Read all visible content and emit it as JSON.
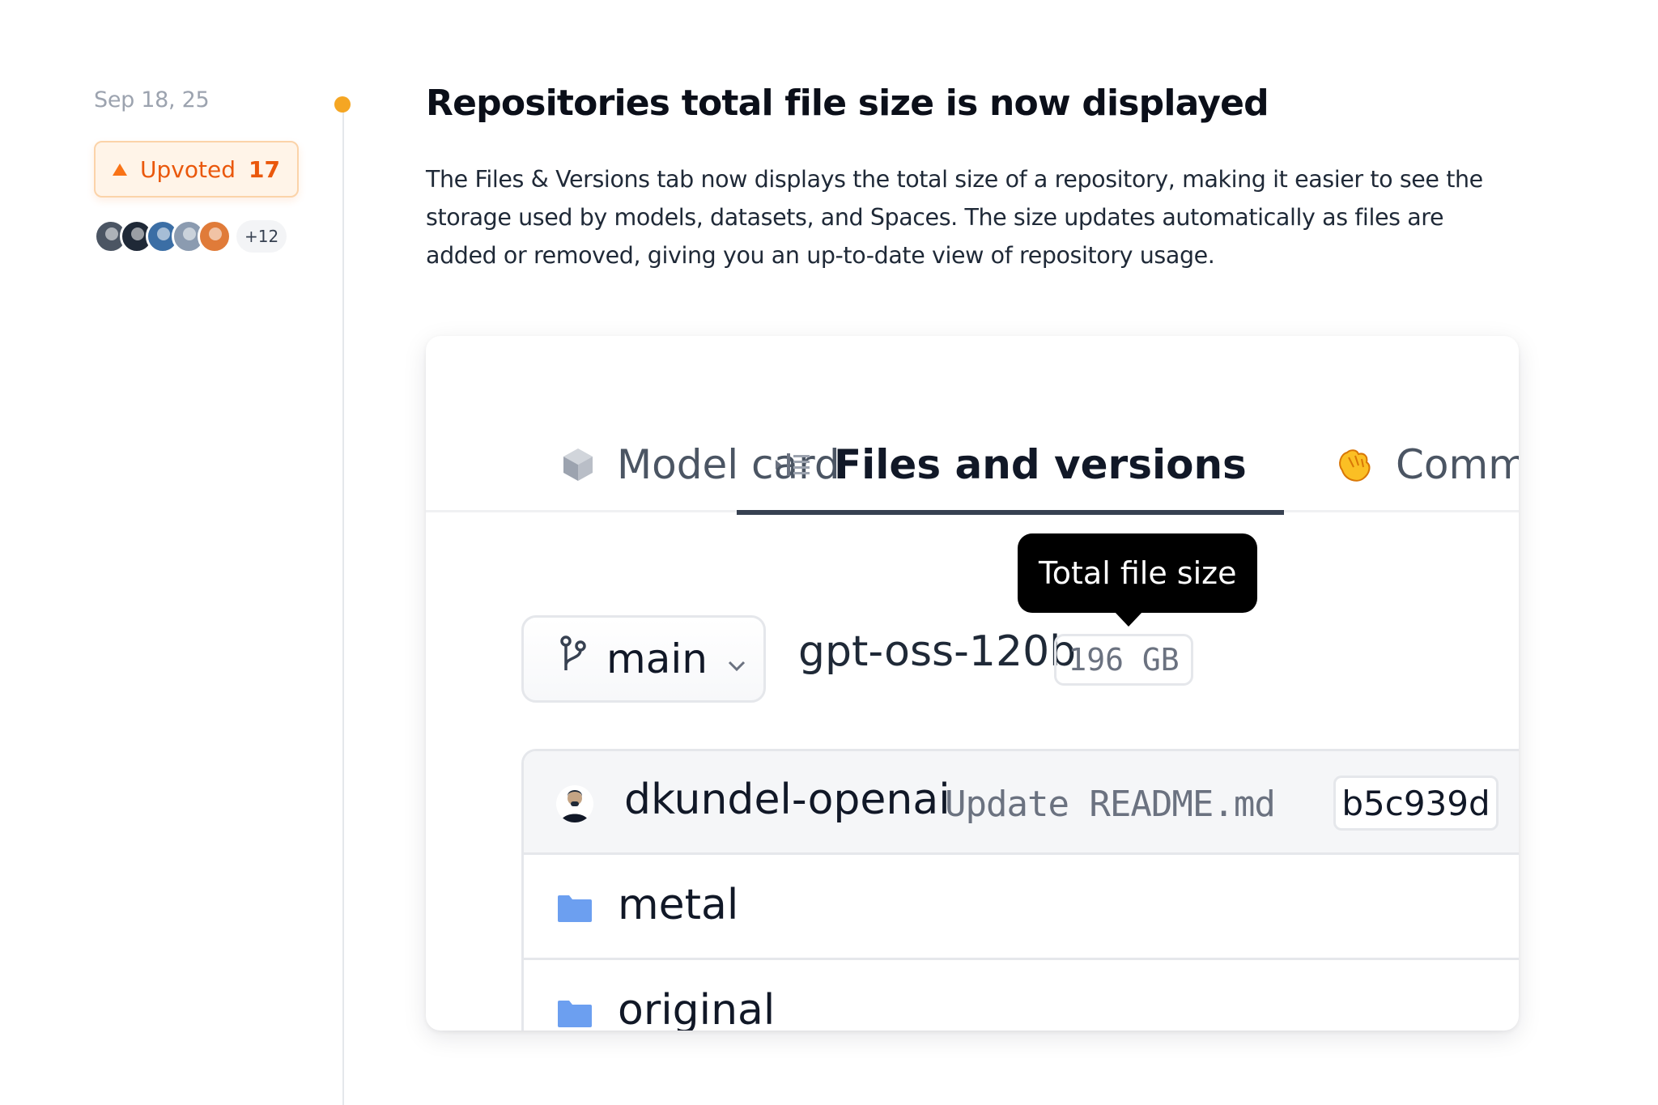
{
  "entry": {
    "date": "Sep 18, 25",
    "upvote": {
      "label": "Upvoted",
      "count": "17"
    },
    "upvoters": {
      "avatar_colors": [
        "#4b5563",
        "#1f2937",
        "#3b6ea5",
        "#8b9bb0",
        "#e07b39"
      ],
      "more": "+12"
    },
    "title": "Repositories total file size is now displayed",
    "description": "The Files & Versions tab now displays the total size of a repository, making it easier to see the storage used by models, datasets, and Spaces. The size updates automatically as files are added or removed, giving you an up-to-date view of repository usage."
  },
  "screenshot": {
    "tabs": [
      {
        "label": "Model card",
        "icon": "cube-icon",
        "active": false
      },
      {
        "label": "Files and versions",
        "icon": "file-tree-icon",
        "active": true
      },
      {
        "label": "Commu",
        "icon": "hand-emoji-icon",
        "active": false
      }
    ],
    "tooltip": "Total file size",
    "branch": {
      "label": "main",
      "icon": "git-branch-icon"
    },
    "repo_name": "gpt-oss-120b",
    "total_size": "196 GB",
    "last_commit": {
      "user": "dkundel-openai",
      "message": "Update README.md",
      "hash": "b5c939d"
    },
    "folders": [
      "metal",
      "original"
    ]
  },
  "colors": {
    "accent_orange": "#f97316",
    "timeline_dot": "#f5a623",
    "folder_blue": "#6c9ff0"
  }
}
